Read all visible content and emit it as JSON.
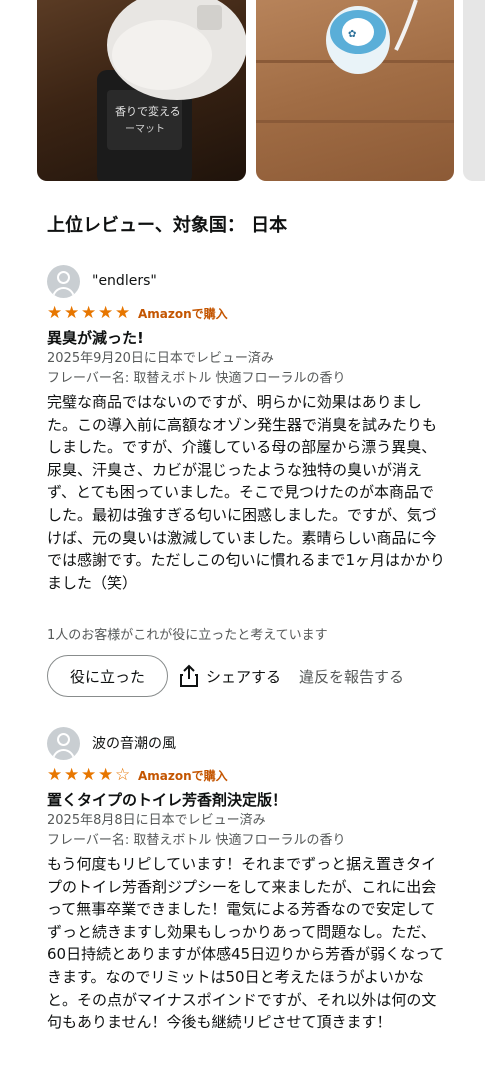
{
  "gallery": {
    "images": [
      "ボトル写真",
      "芳香剤本体写真"
    ]
  },
  "section_title": "上位レビュー、対象国： 日本",
  "reviews": [
    {
      "author": "\"endlers\"",
      "rating": 5,
      "verified": "Amazonで購入",
      "title": "異臭が減った!",
      "date": "2025年9月20日に日本でレビュー済み",
      "variant": "フレーバー名: 取替えボトル 快適フローラルの香り",
      "body": "完璧な商品ではないのですが、明らかに効果はありました。この導入前に高額なオゾン発生器で消臭を試みたりもしました。ですが、介護している母の部屋から漂う異臭、尿臭、汗臭さ、カビが混じったような独特の臭いが消えず、とても困っていました。そこで見つけたのが本商品でした。最初は強すぎる匂いに困惑しました。ですが、気づけば、元の臭いは激減していました。素晴らしい商品に今では感謝です。ただしこの匂いに慣れるまで1ヶ月はかかりました（笑）",
      "helpful_count": "1人のお客様がこれが役に立ったと考えています"
    },
    {
      "author": "波の音潮の風",
      "rating": 4,
      "verified": "Amazonで購入",
      "title": "置くタイプのトイレ芳香剤決定版！",
      "date": "2025年8月8日に日本でレビュー済み",
      "variant": "フレーバー名: 取替えボトル 快適フローラルの香り",
      "body": "もう何度もリピしています！それまでずっと据え置きタイプのトイレ芳香剤ジプシーをして来ましたが、これに出会って無事卒業できました！電気による芳香なので安定してずっと続きますし効果もしっかりあって問題なし。ただ、60日持続とありますが体感45日辺りから芳香が弱くなってきます。なのでリミットは50日と考えたほうがよいかなと。その点がマイナスポインドですが、それ以外は何の文句もありません！今後も継続リピさせて頂きます！"
    }
  ],
  "actions": {
    "helpful_label": "役に立った",
    "share_label": "シェアする",
    "report_label": "違反を報告する"
  },
  "colors": {
    "star": "#e77600",
    "verified": "#c45500",
    "meta": "#565959"
  },
  "icons": {
    "avatar": "person-icon",
    "share": "share-icon",
    "star": "star-icon"
  }
}
